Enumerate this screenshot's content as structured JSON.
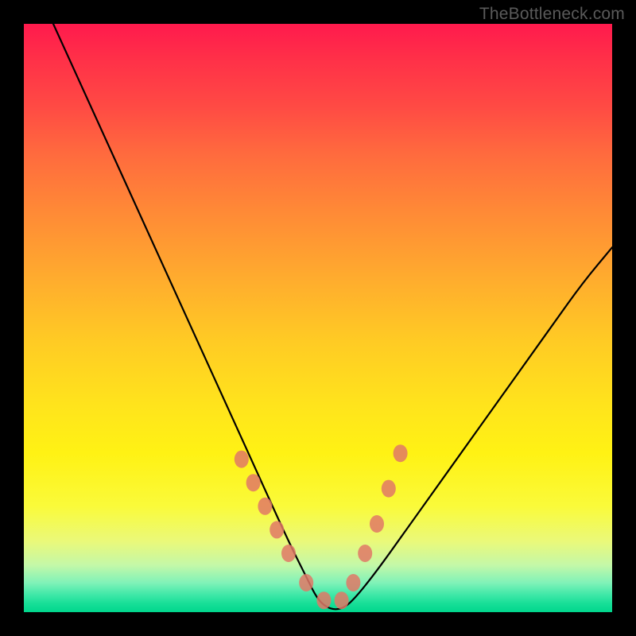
{
  "watermark": "TheBottleneck.com",
  "chart_data": {
    "type": "line",
    "title": "",
    "xlabel": "",
    "ylabel": "",
    "xlim": [
      0,
      100
    ],
    "ylim": [
      0,
      100
    ],
    "series": [
      {
        "name": "bottleneck-curve",
        "x": [
          5,
          10,
          15,
          20,
          25,
          30,
          35,
          40,
          45,
          48,
          50,
          52,
          54,
          56,
          60,
          65,
          70,
          75,
          80,
          85,
          90,
          95,
          100
        ],
        "values": [
          100,
          89,
          78,
          67,
          56,
          45,
          34,
          23,
          12,
          6,
          2,
          0.5,
          0.5,
          2,
          7,
          14,
          21,
          28,
          35,
          42,
          49,
          56,
          62
        ]
      }
    ],
    "markers": {
      "name": "highlight-dots",
      "color": "#e07866",
      "x": [
        37,
        39,
        41,
        43,
        45,
        48,
        51,
        54,
        56,
        58,
        60,
        62,
        64
      ],
      "values": [
        26,
        22,
        18,
        14,
        10,
        5,
        2,
        2,
        5,
        10,
        15,
        21,
        27
      ]
    }
  }
}
